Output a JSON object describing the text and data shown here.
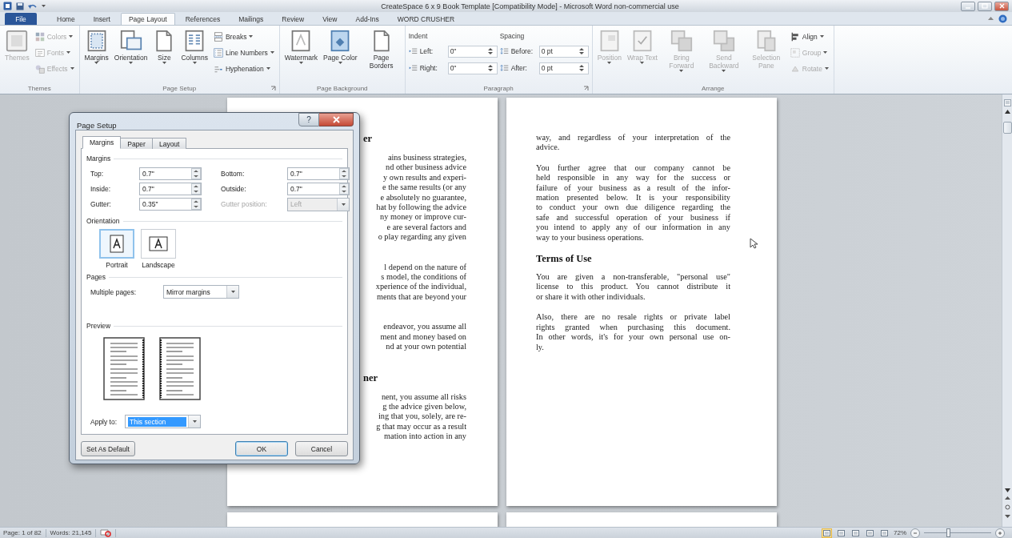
{
  "window": {
    "title": "CreateSpace 6 x 9 Book Template [Compatibility Mode] - Microsoft Word non-commercial use"
  },
  "ribbon_tabs": [
    {
      "label": "File",
      "kind": "file",
      "selected": false
    },
    {
      "label": "Home",
      "kind": "tab",
      "selected": false
    },
    {
      "label": "Insert",
      "kind": "tab",
      "selected": false
    },
    {
      "label": "Page Layout",
      "kind": "tab",
      "selected": true
    },
    {
      "label": "References",
      "kind": "tab",
      "selected": false
    },
    {
      "label": "Mailings",
      "kind": "tab",
      "selected": false
    },
    {
      "label": "Review",
      "kind": "tab",
      "selected": false
    },
    {
      "label": "View",
      "kind": "tab",
      "selected": false
    },
    {
      "label": "Add-Ins",
      "kind": "tab",
      "selected": false
    },
    {
      "label": "WORD CRUSHER",
      "kind": "tab",
      "selected": false
    }
  ],
  "ribbon_groups": [
    {
      "label": "Themes",
      "launcher": false,
      "items": [
        {
          "kind": "large",
          "label": "Themes",
          "dropdown": false,
          "disabled": true
        },
        {
          "kind": "small",
          "label": "Colors",
          "dropdown": true,
          "disabled": true
        },
        {
          "kind": "small",
          "label": "Fonts",
          "dropdown": true,
          "disabled": true
        },
        {
          "kind": "small",
          "label": "Effects",
          "dropdown": true,
          "disabled": true
        }
      ]
    },
    {
      "label": "Page Setup",
      "launcher": true,
      "items": [
        {
          "kind": "large",
          "label": "Margins",
          "dropdown": true,
          "disabled": false
        },
        {
          "kind": "large",
          "label": "Orientation",
          "dropdown": true,
          "disabled": false
        },
        {
          "kind": "large",
          "label": "Size",
          "dropdown": true,
          "disabled": false
        },
        {
          "kind": "large",
          "label": "Columns",
          "dropdown": true,
          "disabled": false
        },
        {
          "kind": "small",
          "label": "Breaks",
          "dropdown": true,
          "disabled": false
        },
        {
          "kind": "small",
          "label": "Line Numbers",
          "dropdown": true,
          "disabled": false
        },
        {
          "kind": "small",
          "label": "Hyphenation",
          "dropdown": true,
          "disabled": false
        }
      ]
    },
    {
      "label": "Page Background",
      "launcher": false,
      "items": [
        {
          "kind": "large",
          "label": "Watermark",
          "dropdown": true,
          "disabled": false
        },
        {
          "kind": "large",
          "label": "Page Color",
          "dropdown": true,
          "disabled": false
        },
        {
          "kind": "large",
          "label": "Page Borders",
          "dropdown": false,
          "disabled": false
        }
      ]
    },
    {
      "label": "Paragraph",
      "launcher": true,
      "items": [
        {
          "kind": "heading",
          "label": "Indent"
        },
        {
          "kind": "spin",
          "label": "Left:",
          "value": "0\""
        },
        {
          "kind": "spin",
          "label": "Right:",
          "value": "0\""
        },
        {
          "kind": "heading",
          "label": "Spacing"
        },
        {
          "kind": "spin",
          "label": "Before:",
          "value": "0 pt"
        },
        {
          "kind": "spin",
          "label": "After:",
          "value": "0 pt"
        }
      ]
    },
    {
      "label": "Arrange",
      "launcher": false,
      "items": [
        {
          "kind": "large",
          "label": "Position",
          "dropdown": true,
          "disabled": true
        },
        {
          "kind": "large",
          "label": "Wrap Text",
          "dropdown": true,
          "disabled": true
        },
        {
          "kind": "large",
          "label": "Bring Forward",
          "dropdown": true,
          "disabled": true
        },
        {
          "kind": "large",
          "label": "Send Backward",
          "dropdown": true,
          "disabled": true
        },
        {
          "kind": "large",
          "label": "Selection Pane",
          "dropdown": false,
          "disabled": true
        },
        {
          "kind": "small",
          "label": "Align",
          "dropdown": true,
          "disabled": false
        },
        {
          "kind": "small",
          "label": "Group",
          "dropdown": true,
          "disabled": true
        },
        {
          "kind": "small",
          "label": "Rotate",
          "dropdown": true,
          "disabled": true
        }
      ]
    }
  ],
  "document": {
    "left_page": [
      {
        "kind": "heading",
        "lines": [
          "er"
        ]
      },
      {
        "kind": "paragraph",
        "lines": [
          "ains business strategies,",
          "nd other business advice",
          "y own results and experi-",
          "e the same results (or any",
          "e absolutely no guarantee,",
          "hat by following the advice",
          "ny money or improve cur-",
          "e are several factors and",
          "o play regarding any given"
        ]
      },
      {
        "kind": "paragraph",
        "lines": [
          "l depend on the nature of",
          "s model, the conditions of",
          "xperience of the individual,",
          "ments that are beyond your"
        ]
      },
      {
        "kind": "paragraph",
        "lines": [
          "endeavor, you assume all",
          "ment and money based on",
          "nd at your own potential"
        ]
      },
      {
        "kind": "heading",
        "lines": [
          "ner"
        ]
      },
      {
        "kind": "paragraph",
        "lines": [
          "nent, you assume all risks",
          "g the advice given below,",
          "ing that you, solely, are re-",
          "g that may occur as a result",
          "mation into action in any"
        ]
      }
    ],
    "right_page": [
      {
        "kind": "paragraph",
        "lines": [
          "way, and regardless of your interpretation of the",
          "advice."
        ]
      },
      {
        "kind": "paragraph",
        "lines": [
          "You further agree that our company cannot be",
          "held responsible in any way for the success or",
          "failure of your business as a result of the infor-",
          "mation presented below. It is your responsibility",
          "to conduct your own due diligence regarding the",
          "safe and successful operation of your business if",
          "you intend to apply any of our information in any",
          "way to your business operations."
        ]
      },
      {
        "kind": "heading",
        "lines": [
          "Terms of Use"
        ]
      },
      {
        "kind": "paragraph",
        "lines": [
          "You are given a non-transferable, \"personal use\"",
          "license to this product. You cannot distribute it",
          "or share it with other individuals."
        ]
      },
      {
        "kind": "paragraph",
        "lines": [
          "Also, there are no resale rights or private label",
          "rights granted when purchasing this document.",
          "In other words, it's for your own personal use on-",
          "ly."
        ]
      }
    ]
  },
  "dialog": {
    "title": "Page Setup",
    "help": "?",
    "tabs": [
      {
        "label": "Margins",
        "selected": true
      },
      {
        "label": "Paper",
        "selected": false
      },
      {
        "label": "Layout",
        "selected": false
      }
    ],
    "margins_label": "Margins",
    "margin_fields": [
      {
        "label": "Top:",
        "value": "0.7\"",
        "kind": "spin",
        "disabled": false
      },
      {
        "label": "Bottom:",
        "value": "0.7\"",
        "kind": "spin",
        "disabled": false
      },
      {
        "label": "Inside:",
        "value": "0.7\"",
        "kind": "spin",
        "disabled": false
      },
      {
        "label": "Outside:",
        "value": "0.7\"",
        "kind": "spin",
        "disabled": false
      },
      {
        "label": "Gutter:",
        "value": "0.35\"",
        "kind": "spin",
        "disabled": false
      },
      {
        "label": "Gutter position:",
        "value": "Left",
        "kind": "dropdown",
        "disabled": true
      }
    ],
    "orientation_label": "Orientation",
    "orientations": [
      {
        "label": "Portrait",
        "kind": "portrait",
        "selected": true
      },
      {
        "label": "Landscape",
        "kind": "landscape",
        "selected": false
      }
    ],
    "pages_label": "Pages",
    "multiple_pages": {
      "label": "Multiple pages:",
      "value": "Mirror margins"
    },
    "preview_label": "Preview",
    "apply_to": {
      "label": "Apply to:",
      "value": "This section",
      "highlighted": true
    },
    "buttons": [
      {
        "label": "Set As Default",
        "kind": "left",
        "default": false
      },
      {
        "label": "OK",
        "kind": "right",
        "default": true
      },
      {
        "label": "Cancel",
        "kind": "right",
        "default": false
      }
    ]
  },
  "status_bar": {
    "page": "Page: 1 of 82",
    "words": "Words: 21,145",
    "views": [
      {
        "selected": true
      },
      {
        "selected": false
      },
      {
        "selected": false
      },
      {
        "selected": false
      },
      {
        "selected": false
      }
    ],
    "zoom": "72%",
    "zoom_slider": {
      "level": 0.35
    }
  }
}
